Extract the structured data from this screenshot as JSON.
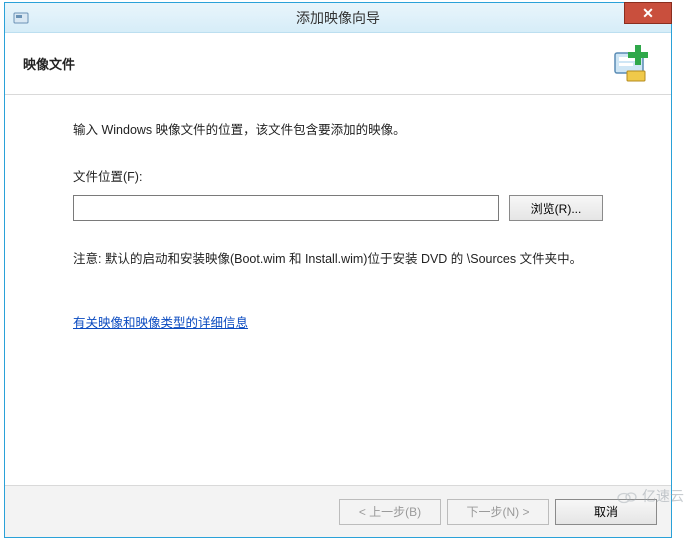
{
  "titlebar": {
    "title": "添加映像向导",
    "close_icon": "x"
  },
  "header": {
    "title": "映像文件"
  },
  "content": {
    "intro": "输入 Windows 映像文件的位置，该文件包含要添加的映像。",
    "file_label": "文件位置(F):",
    "file_value": "",
    "browse_label": "浏览(R)...",
    "note": "注意: 默认的启动和安装映像(Boot.wim 和 Install.wim)位于安装 DVD 的 \\Sources 文件夹中。",
    "link_text": "有关映像和映像类型的详细信息"
  },
  "footer": {
    "back_label": "< 上一步(B)",
    "next_label": "下一步(N) >",
    "cancel_label": "取消"
  },
  "watermark": {
    "text": "亿速云"
  }
}
